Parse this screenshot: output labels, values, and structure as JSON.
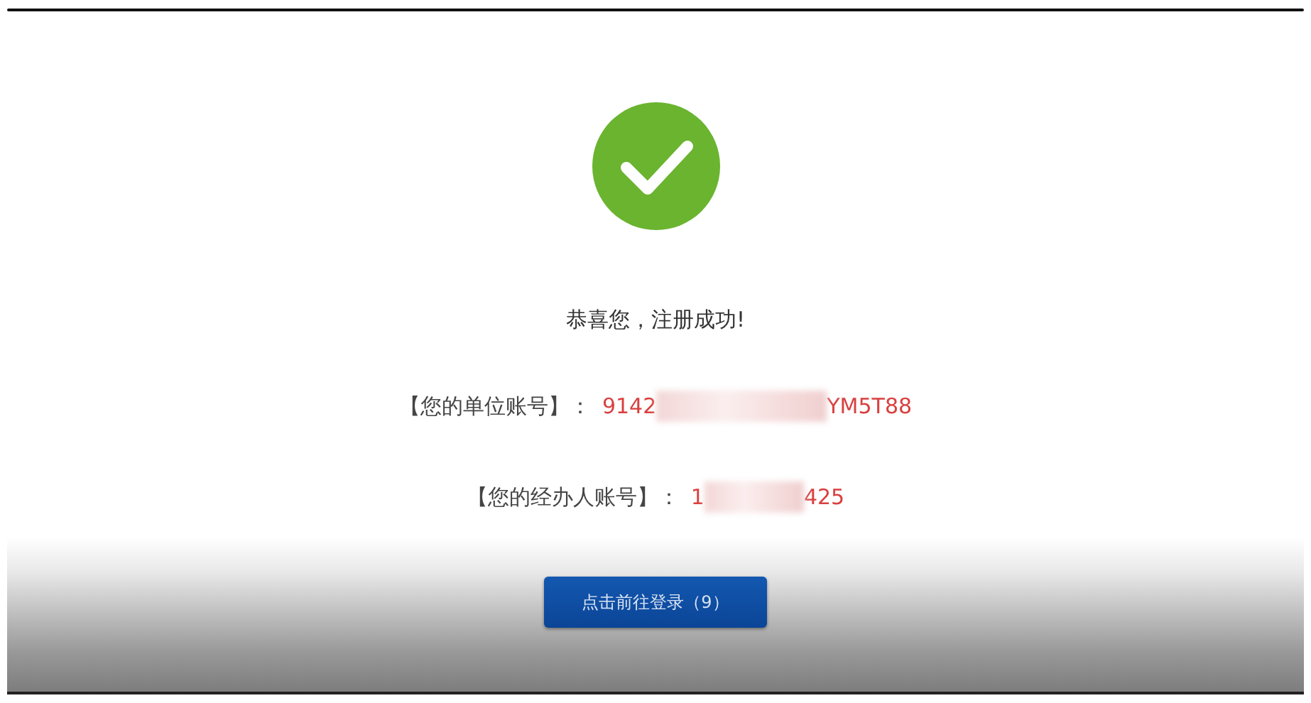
{
  "message": "恭喜您，注册成功!",
  "accounts": [
    {
      "label": "【您的单位账号】：",
      "value_start": "9142",
      "value_end": "YM5T88"
    },
    {
      "label": "【您的经办人账号】：",
      "value_start": "1",
      "value_end": "425"
    }
  ],
  "button": {
    "label": "点击前往登录（9）"
  }
}
